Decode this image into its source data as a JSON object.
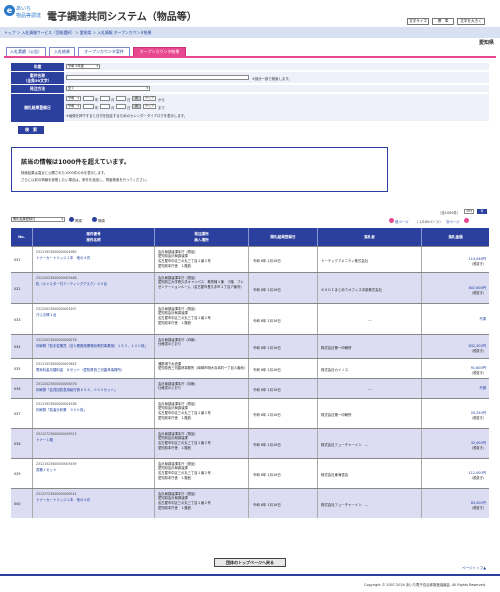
{
  "header": {
    "logo_text_1": "あいち",
    "logo_text_2": "物品等調達",
    "title": "電子調達共同システム（物品等）",
    "font_size_label": "文字サイズ",
    "font_standard": "標　準",
    "font_large": "文字を大きく"
  },
  "breadcrumb": "トップ ＞ 入札情報サービス（団体選択）＞ 愛知県 ＞ 入札情報 オープンカウンタ結果",
  "prefecture": "愛知県",
  "tabs": [
    {
      "label": "入札実績（公告）",
      "active": false
    },
    {
      "label": "入札結果",
      "active": false
    },
    {
      "label": "オープンカウンタ案件",
      "active": false
    },
    {
      "label": "オープンカウンタ結果",
      "active": true
    }
  ],
  "form": {
    "year_label": "年度",
    "year_value": "令和 5年度",
    "case_label": "案件名称",
    "case_label_sub": "（全角50文字）",
    "case_note": "※部分一致で検索します。",
    "method_label": "発注方法",
    "method_value": "全て",
    "date_label": "開札結果登録日",
    "date_era": "令和",
    "date_y_unit": "年",
    "date_m_unit": "月",
    "date_d_unit": "日",
    "cal_label": "暦",
    "clear_label": "クリア",
    "from_label": "から",
    "to_label": "まで",
    "date_note": "※画像を押下すると日付を指定するためのカレンダーダイアログを表示します。",
    "search_button": "検　索"
  },
  "notice": {
    "heading": "該当の情報は1000件を超えています。",
    "line1": "検索結果は直近に公開された1000件のみを表示します。",
    "line2": "さらに以前の情報を参照したい場合は、条件を追加し、再度検索を行ってください。"
  },
  "controls": {
    "sort_value": "開札結果登録日",
    "asc_label": "昇順",
    "desc_label": "降順",
    "total_count": "（全1000件）",
    "per_page": "10",
    "per_page_unit": "件",
    "prev_label": "前ページ",
    "page_info": "（ 1/100ページ）",
    "next_label": "次ページ"
  },
  "table": {
    "headers": {
      "no": "No.",
      "case": "案件番号\n案件名称",
      "org": "発注課所\n納入場所",
      "date": "開札結果登録日",
      "winner": "落札者",
      "amount": "落札金額"
    },
    "rows": [
      {
        "no": "031",
        "case_no": "23121923000000004983",
        "case_name": "トナーカートリッジ１本　他の４件",
        "org": "会計局調達課本庁（物品）",
        "place": "愛知県会計局調達課\n名古屋市中区三の丸三丁目１番２号\n愛知県本庁舎　１階西",
        "date": "令和 6年 1月16日",
        "winner": "トーテックアメニティ株式会社",
        "amount": "114,048円",
        "amount_note": "（税抜き）"
      },
      {
        "no": "032",
        "case_no": "23122023000000005466",
        "case_name": "机（キャスター付ミーティングデスク）４５台",
        "org": "会計局調達課本庁（物品）",
        "place": "愛知県立大学長久手キャンパス　教育棟１棟　３階　プレゼンテーションルーム（名古屋市長久手市１丁目ア番号）",
        "date": "令和 6年 1月16日",
        "winner": "ＫＤＤＩまとめてオフィス中部株式会社",
        "amount": "802,600円",
        "amount_note": "（税抜き）"
      },
      {
        "no": "033",
        "case_no": "23122023000000005207",
        "case_name": "汗ふき棒１台",
        "org": "会計局調達課本庁（物品）",
        "place": "愛知県会計局調達課\n名古屋市中区三の丸三丁目１番２号\n愛知県本庁舎　１階西",
        "date": "令和 6年 1月16日",
        "winner": "---",
        "amount": "不調",
        "amount_note": ""
      },
      {
        "no": "034",
        "case_no": "23122023000000006278",
        "case_name": "印刷物「若手従業員（法人業務用業務効率的事業用）１５３，１００枚」",
        "org": "会計局調達課本庁（印刷）",
        "place": "仕様書のとおり",
        "date": "令和 6年 1月16日",
        "winner": "株式会社第一印刷所",
        "amount": "832,300円",
        "amount_note": "（税抜き）"
      },
      {
        "no": "035",
        "case_no": "23121523000000003625",
        "case_name": "電気料金月額料金　８セット（愛知県西三河農林事務所）",
        "org": "蒲郡港下水道課",
        "place": "愛知県西三河農林事務所（岡崎市明大寺本町一丁目４番地）",
        "date": "令和 6年 1月16日",
        "winner": "株式会社カイノス",
        "amount": "91,600円",
        "amount_note": "（税抜き）"
      },
      {
        "no": "036",
        "case_no": "23122023000000006376",
        "case_name": "印刷物「会員回覧表用紙付冊６５４，０００セット」",
        "org": "会計局調達課本庁（印刷）",
        "place": "仕様書のとおり",
        "date": "令和 6年 1月16日",
        "winner": "---",
        "amount": "不調",
        "amount_note": ""
      },
      {
        "no": "037",
        "case_no": "23121923000000004538",
        "case_name": "印刷物「若者分析業　９００枚」",
        "org": "会計局調達課本庁（物品）",
        "place": "愛知県会計局調達課\n名古屋市中区三の丸三丁目１番２号\n愛知県本庁舎　１階西",
        "date": "令和 6年 1月16日",
        "winner": "株式会社第一印刷所",
        "amount": "29,250円",
        "amount_note": "（税抜き）"
      },
      {
        "no": "038",
        "case_no": "23122723000000006313",
        "case_name": "トナー１箱",
        "org": "会計局調達課本庁（物品）",
        "place": "愛知県会計局調達課\n名古屋市中区三の丸三丁目１番２号\n愛知県本庁舎　１階西",
        "date": "令和 6年 1月16日",
        "winner": "株式会社フューチャーイン　...",
        "amount": "32,400円",
        "amount_note": "（税抜き）"
      },
      {
        "no": "039",
        "case_no": "23121523000000005459",
        "case_name": "書籍１セット",
        "org": "会計局調達課本庁（物品）",
        "place": "愛知県会計局調達課\n名古屋市中区三の丸三丁目１番２号\n愛知県本庁舎　１階西",
        "date": "令和 6年 1月16日",
        "winner": "株式会社東海書会",
        "amount": "112,000円",
        "amount_note": "（税抜き）"
      },
      {
        "no": "040",
        "case_no": "23122723000000006314",
        "case_name": "トナーカートリッジ１本　他の４件",
        "org": "会計局調達課本庁（物品）",
        "place": "愛知県会計局調達課\n名古屋市中区三の丸三丁目１番２号\n愛知県本庁舎　１階西",
        "date": "令和 6年 1月16日",
        "winner": "株式会社フューチャーイン　...",
        "amount": "83,000円",
        "amount_note": "（税抜き）"
      }
    ]
  },
  "footer": {
    "back_button": "団体のトップページへ戻る",
    "to_top": "ページトップ▲",
    "copyright": "Copyright © 2007-2024 あいち電子自治体推進協議会. All Rights Reserved."
  }
}
